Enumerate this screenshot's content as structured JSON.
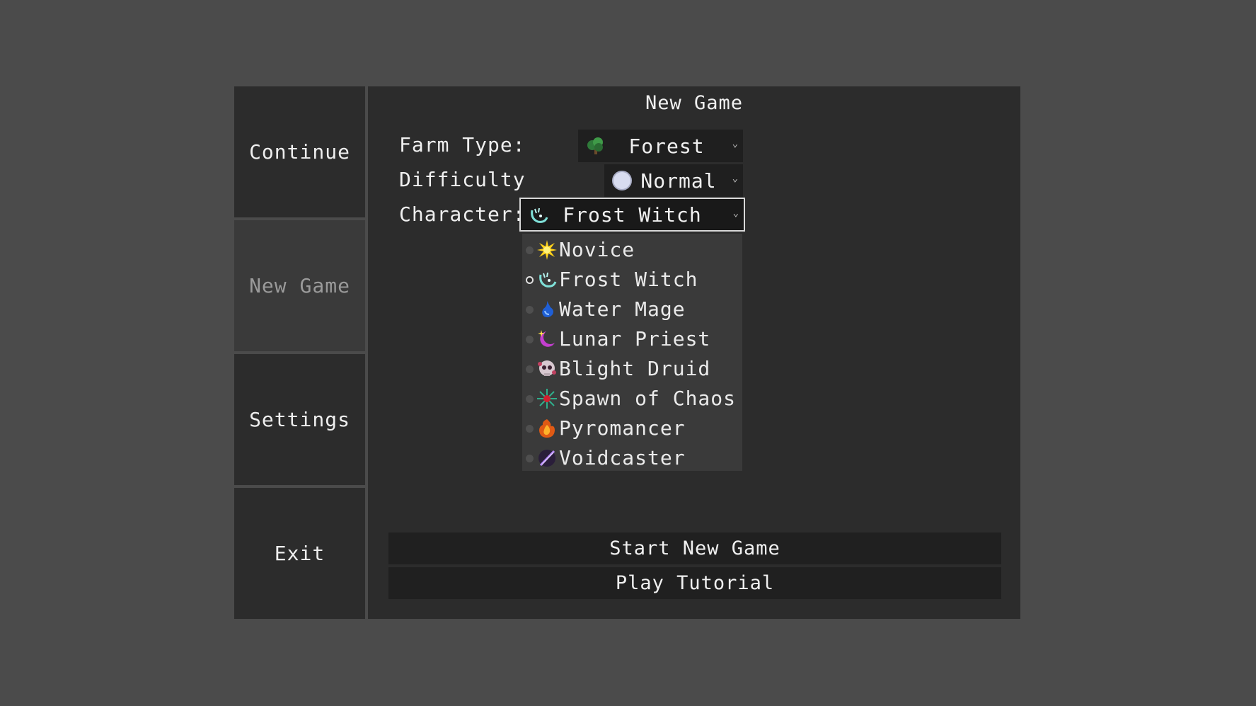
{
  "side_menu": {
    "items": [
      {
        "label": "Continue"
      },
      {
        "label": "New Game",
        "active": true
      },
      {
        "label": "Settings"
      },
      {
        "label": "Exit"
      }
    ]
  },
  "panel": {
    "title": "New Game",
    "farm_type": {
      "label": "Farm Type:",
      "value": "Forest",
      "icon": "tree-icon"
    },
    "difficulty": {
      "label": "Difficulty",
      "value": "Normal",
      "icon": "circle-icon"
    },
    "character": {
      "label": "Character:",
      "value": "Frost Witch",
      "icon": "frost-witch-icon",
      "options": [
        {
          "label": "Novice",
          "icon": "sun-icon"
        },
        {
          "label": "Frost Witch",
          "icon": "frost-witch-icon",
          "selected": true
        },
        {
          "label": "Water Mage",
          "icon": "water-drop-icon"
        },
        {
          "label": "Lunar Priest",
          "icon": "moon-icon"
        },
        {
          "label": "Blight Druid",
          "icon": "skull-icon"
        },
        {
          "label": "Spawn of Chaos",
          "icon": "chaos-burst-icon"
        },
        {
          "label": "Pyromancer",
          "icon": "fire-icon"
        },
        {
          "label": "Voidcaster",
          "icon": "void-blade-icon"
        }
      ]
    },
    "start_button": "Start New Game",
    "tutorial_button": "Play Tutorial"
  },
  "colors": {
    "background": "#4b4b4b",
    "panel": "#2c2c2c",
    "active_menu": "#3a3a3a",
    "dropdown_list": "#3a3a3a"
  }
}
